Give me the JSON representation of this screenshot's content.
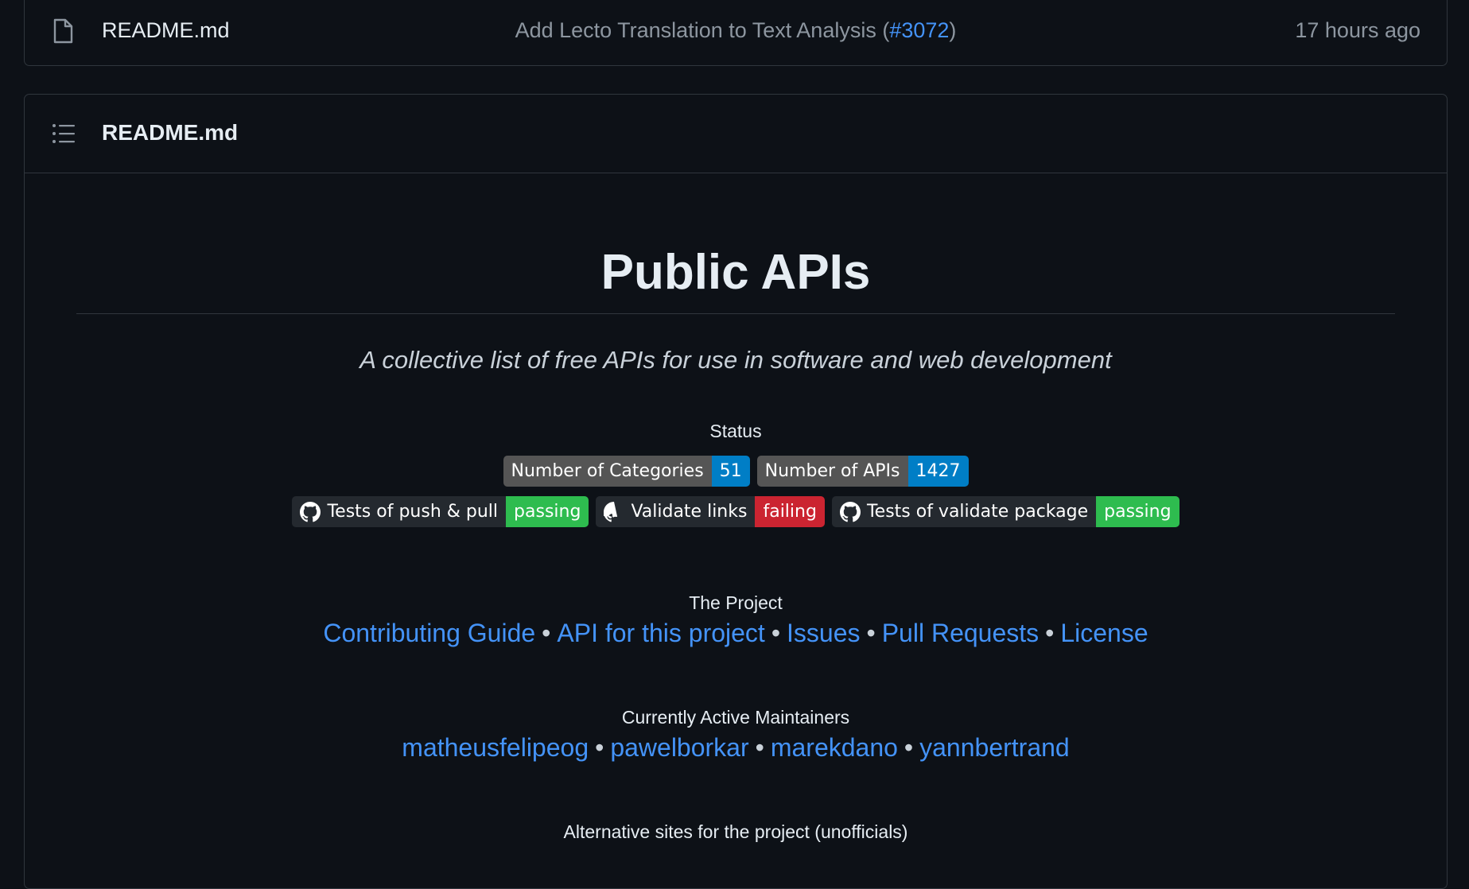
{
  "file_row": {
    "name": "README.md",
    "commit_message": "Add Lecto Translation to Text Analysis (",
    "commit_pr": "#3072",
    "commit_close": ")",
    "time": "17 hours ago"
  },
  "readme": {
    "header_title": "README.md",
    "title": "Public APIs",
    "tagline": "A collective list of free APIs for use in software and web development",
    "status_label": "Status",
    "badges_row1": [
      {
        "label": "Number of Categories",
        "value": "51",
        "color": "#007ec6"
      },
      {
        "label": "Number of APIs",
        "value": "1427",
        "color": "#007ec6"
      }
    ],
    "badges_row2": [
      {
        "label": "Tests of push & pull",
        "value": "passing",
        "color": "#2ebc4f"
      },
      {
        "label": "Validate links",
        "value": "failing",
        "color": "#cb2431"
      },
      {
        "label": "Tests of validate package",
        "value": "passing",
        "color": "#2ebc4f"
      }
    ],
    "project_label": "The Project",
    "project_links": [
      "Contributing Guide",
      "API for this project",
      "Issues",
      "Pull Requests",
      "License"
    ],
    "maintainers_label": "Currently Active Maintainers",
    "maintainers": [
      "matheusfelipeog",
      "pawelborkar",
      "marekdano",
      "yannbertrand"
    ],
    "alt_sites_label": "Alternative sites for the project (unofficials)",
    "separator": "•"
  },
  "icons": {
    "file": "file-icon",
    "toc": "list-icon",
    "github": "github-icon"
  },
  "colors": {
    "background": "#0d1117",
    "border": "#30363d",
    "link": "#4493f8",
    "muted": "#8d96a0"
  }
}
